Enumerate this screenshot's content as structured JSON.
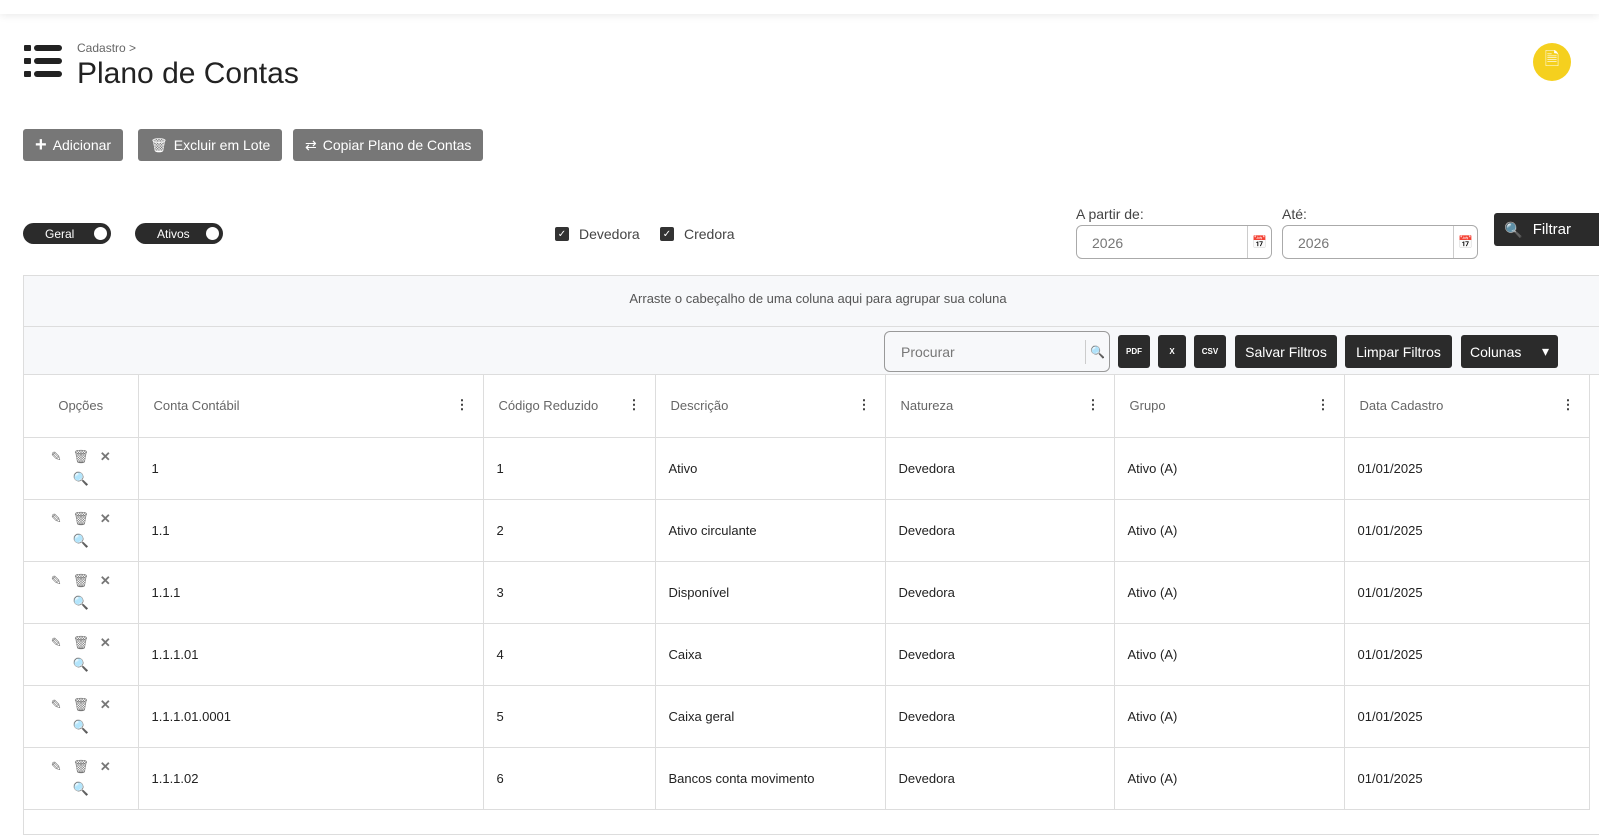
{
  "breadcrumb": "Cadastro",
  "title": "Plano de Contas",
  "actions": [
    {
      "label": "Adicionar",
      "icon": "plus-icon"
    },
    {
      "label": "Excluir em Lote",
      "icon": "trash-icon"
    },
    {
      "label": "Copiar Plano de Contas",
      "icon": "swap-icon"
    }
  ],
  "toggles": [
    {
      "label": "Geral",
      "on": true
    },
    {
      "label": "Ativos",
      "on": true
    }
  ],
  "checkboxes": [
    {
      "label": "Devedora",
      "checked": true
    },
    {
      "label": "Credora",
      "checked": true
    }
  ],
  "date_from": {
    "label": "A partir de:",
    "value": "2026"
  },
  "date_to": {
    "label": "Até:",
    "value": "2026"
  },
  "filter_label": "Filtrar",
  "group_hint": "Arraste o cabeçalho de uma coluna aqui para agrupar sua coluna",
  "search_placeholder": "Procurar",
  "export": [
    "PDF",
    "X",
    "CSV"
  ],
  "save_filters": "Salvar Filtros",
  "clear_filters": "Limpar Filtros",
  "columns_label": "Colunas",
  "headers": [
    "Opções",
    "Conta Contábil",
    "Código Reduzido",
    "Descrição",
    "Natureza",
    "Grupo",
    "Data Cadastro"
  ],
  "rows": [
    [
      "1",
      "1",
      "Ativo",
      "Devedora",
      "Ativo (A)",
      "01/01/2025"
    ],
    [
      "1.1",
      "2",
      "Ativo circulante",
      "Devedora",
      "Ativo (A)",
      "01/01/2025"
    ],
    [
      "1.1.1",
      "3",
      "Disponível",
      "Devedora",
      "Ativo (A)",
      "01/01/2025"
    ],
    [
      "1.1.1.01",
      "4",
      "Caixa",
      "Devedora",
      "Ativo (A)",
      "01/01/2025"
    ],
    [
      "1.1.1.01.0001",
      "5",
      "Caixa geral",
      "Devedora",
      "Ativo (A)",
      "01/01/2025"
    ],
    [
      "1.1.1.02",
      "6",
      "Bancos conta movimento",
      "Devedora",
      "Ativo (A)",
      "01/01/2025"
    ]
  ],
  "colors": {
    "accent": "#f5d01e",
    "dark": "#2b2b2b",
    "button": "#777777"
  }
}
